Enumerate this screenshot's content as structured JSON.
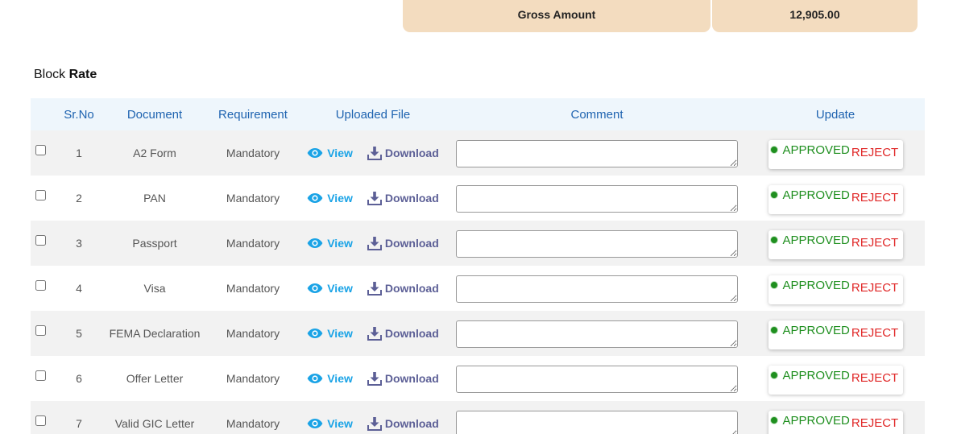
{
  "gross": {
    "label": "Gross Amount",
    "value": "12,905.00"
  },
  "section": {
    "title_prefix": "Block",
    "title_bold": "Rate"
  },
  "table": {
    "headers": {
      "srno": "Sr.No",
      "document": "Document",
      "requirement": "Requirement",
      "uploaded_file": "Uploaded File",
      "comment": "Comment",
      "update": "Update"
    },
    "view_label": "View",
    "download_label": "Download",
    "approved_label": "APPROVED",
    "reject_label": "REJECT",
    "rows": [
      {
        "srno": "1",
        "document": "A2 Form",
        "requirement": "Mandatory"
      },
      {
        "srno": "2",
        "document": "PAN",
        "requirement": "Mandatory"
      },
      {
        "srno": "3",
        "document": "Passport",
        "requirement": "Mandatory"
      },
      {
        "srno": "4",
        "document": "Visa",
        "requirement": "Mandatory"
      },
      {
        "srno": "5",
        "document": "FEMA Declaration",
        "requirement": "Mandatory"
      },
      {
        "srno": "6",
        "document": "Offer Letter",
        "requirement": "Mandatory"
      },
      {
        "srno": "7",
        "document": "Valid GIC Letter",
        "requirement": "Mandatory"
      }
    ]
  },
  "colors": {
    "header_text": "#1e63b0",
    "view_link": "#1aa3e6",
    "download_link": "#5c5f96",
    "approved": "#1f8f1f",
    "reject": "#e02626",
    "gross_bg": "#f3dcbf"
  },
  "icons": {
    "view": "eye-icon",
    "download": "download-icon"
  }
}
